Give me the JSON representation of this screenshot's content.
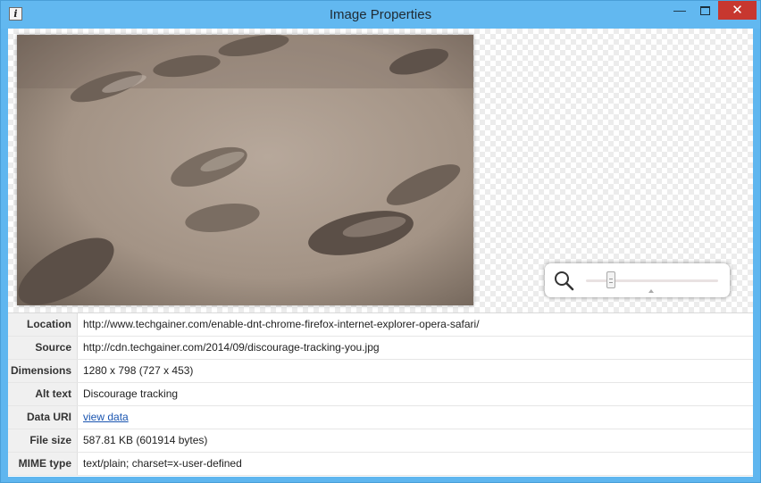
{
  "window": {
    "title": "Image Properties",
    "app_icon": "info-icon",
    "controls": {
      "minimize": "—",
      "close": "✕"
    }
  },
  "preview": {
    "image_description_icon": "sand-footprints-photo",
    "zoom_icon": "magnifier-icon",
    "zoom_level_fraction": 0.19
  },
  "properties": [
    {
      "label": "Location",
      "value": "http://www.techgainer.com/enable-dnt-chrome-firefox-internet-explorer-opera-safari/"
    },
    {
      "label": "Source",
      "value": "http://cdn.techgainer.com/2014/09/discourage-tracking-you.jpg"
    },
    {
      "label": "Dimensions",
      "value": "1280 x 798 (727 x 453)"
    },
    {
      "label": "Alt text",
      "value": "Discourage tracking"
    },
    {
      "label": "Data URI",
      "value": "view data"
    },
    {
      "label": "File size",
      "value": "587.81 KB (601914 bytes)"
    },
    {
      "label": "MIME type",
      "value": "text/plain; charset=x-user-defined"
    }
  ]
}
